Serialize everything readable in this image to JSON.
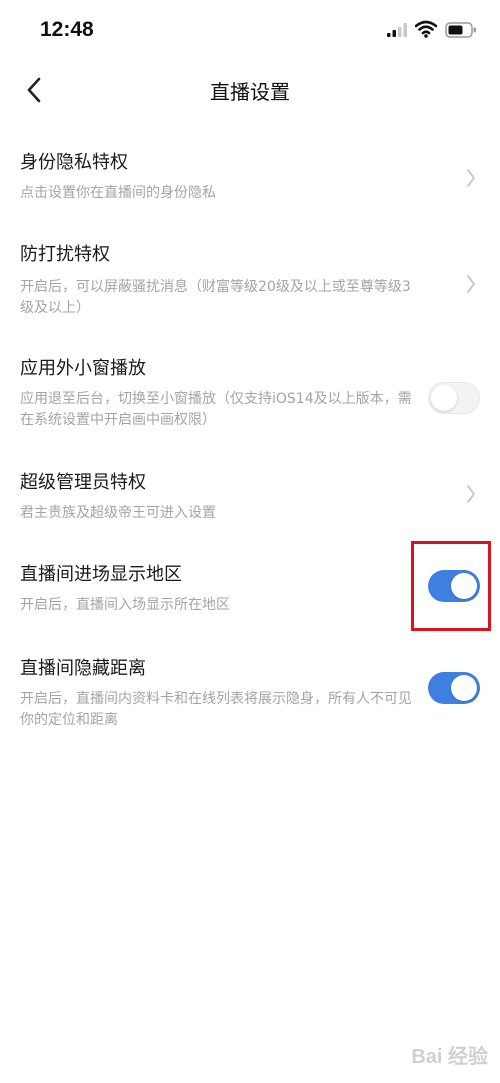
{
  "status_bar": {
    "time": "12:48"
  },
  "nav": {
    "title": "直播设置"
  },
  "items": [
    {
      "title": "身份隐私特权",
      "desc": "点击设置你在直播间的身份隐私",
      "control": "chevron"
    },
    {
      "title": "防打扰特权",
      "desc": "开启后，可以屏蔽骚扰消息（财富等级20级及以上或至尊等级3级及以上）",
      "control": "chevron"
    },
    {
      "title": "应用外小窗播放",
      "desc": "应用退至后台，切换至小窗播放（仅支持iOS14及以上版本，需在系统设置中开启画中画权限）",
      "control": "toggle",
      "on": false
    },
    {
      "title": "超级管理员特权",
      "desc": "君主贵族及超级帝王可进入设置",
      "control": "chevron"
    },
    {
      "title": "直播间进场显示地区",
      "desc": "开启后，直播间入场显示所在地区",
      "control": "toggle",
      "on": true
    },
    {
      "title": "直播间隐藏距离",
      "desc": "开启后，直播间内资料卡和在线列表将展示隐身，所有人不可见你的定位和距离",
      "control": "toggle",
      "on": true
    }
  ],
  "colors": {
    "toggle_on": "#3f7fe0",
    "highlight": "#d9141e"
  },
  "icons": {
    "back": "chevron-left-icon",
    "row": "chevron-right-icon",
    "signal": "signal-icon",
    "wifi": "wifi-icon",
    "battery": "battery-icon"
  },
  "watermark": "Bai 经验"
}
